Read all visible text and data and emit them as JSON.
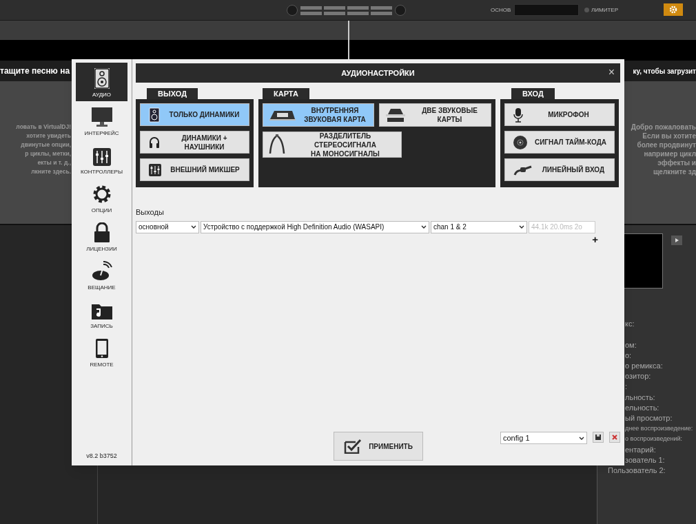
{
  "top_bar": {
    "master_label": "ОСНОВ",
    "limiter_label": "ЛИМИТЕР"
  },
  "drop_hint_left": "тащите песню на",
  "drop_hint_right": "ку, чтобы загрузит",
  "welcome_left": [
    "ловать в VirtualDJ!",
    "хотите увидеть",
    "двинутые опции,",
    "р циклы, метки,",
    "екты и т. д.,",
    "лкните здесь."
  ],
  "welcome_right": [
    "Добро пожаловать",
    "Если вы хотите",
    "более продвинут",
    "например цикл",
    "эффекты и",
    "щелкните зд"
  ],
  "info_labels": [
    "кс:",
    "ом:",
    "о:",
    "о ремикса:",
    "озитор:",
    ":",
    "льность:",
    "ельность:",
    "ый просмотр:",
    "днее воспроизведение:",
    "о воспроизведений:",
    "ентарий:",
    "зователь 1:",
    "Пользователь 2:"
  ],
  "dialog": {
    "title": "АУДИОНАСТРОЙКИ",
    "close": "×",
    "sidebar": [
      {
        "label": "АУДИО",
        "selected": true
      },
      {
        "label": "ИНТЕРФЕЙС",
        "selected": false
      },
      {
        "label": "КОНТРОЛЛЕРЫ",
        "selected": false
      },
      {
        "label": "ОПЦИИ",
        "selected": false
      },
      {
        "label": "ЛИЦЕНЗИИ",
        "selected": false
      },
      {
        "label": "ВЕЩАНИЕ",
        "selected": false
      },
      {
        "label": "ЗАПИСЬ",
        "selected": false
      },
      {
        "label": "REMOTE",
        "selected": false
      }
    ],
    "version": "v8.2 b3752",
    "groups": [
      {
        "title": "ВЫХОД",
        "options": [
          {
            "label": "ТОЛЬКО ДИНАМИКИ",
            "selected": true
          },
          {
            "label": "ДИНАМИКИ +\nНАУШНИКИ",
            "selected": false
          },
          {
            "label": "ВНЕШНИЙ МИКШЕР",
            "selected": false
          }
        ]
      },
      {
        "title": "КАРТА",
        "options": [
          {
            "label": "ВНУТРЕННЯЯ\nЗВУКОВАЯ КАРТА",
            "selected": true
          },
          {
            "label": "ДВЕ ЗВУКОВЫЕ КАРТЫ",
            "selected": false
          },
          {
            "label": "РАЗДЕЛИТЕЛЬ\nСТЕРЕОСИГНАЛА\nНА МОНОСИГНАЛЫ",
            "selected": false
          }
        ]
      },
      {
        "title": "ВХОД",
        "options": [
          {
            "label": "МИКРОФОН",
            "selected": false
          },
          {
            "label": "СИГНАЛ ТАЙМ-КОДА",
            "selected": false
          },
          {
            "label": "ЛИНЕЙНЫЙ ВХОД",
            "selected": false
          }
        ]
      }
    ],
    "outputs_label": "Выходы",
    "output_row": {
      "channel": "основной",
      "device": "Устройство с поддержкой High Definition Audio (WASAPI)",
      "pair": "chan 1 & 2",
      "info": "44.1k 20.0ms 2o"
    },
    "add": "+",
    "apply": "ПРИМЕНИТЬ",
    "config": "config 1"
  }
}
